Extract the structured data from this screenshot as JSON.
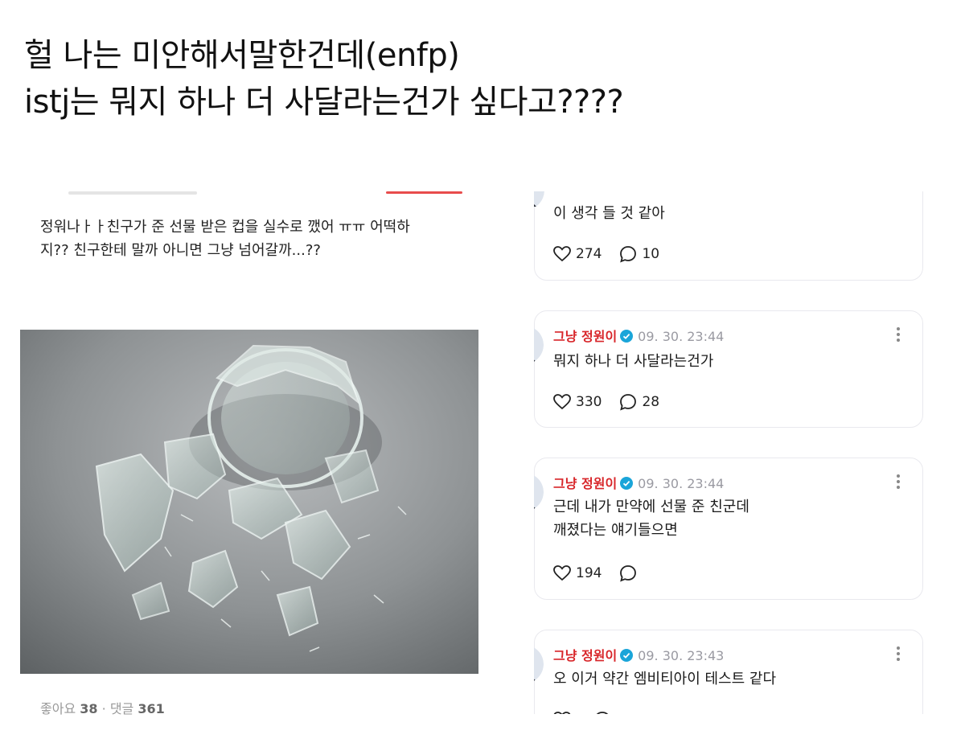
{
  "caption": {
    "line1": "헐 나는 미안해서말한건데(enfp)",
    "line2": "istj는 뭐지 하나 더 사달라는건가 싶다고????"
  },
  "post": {
    "text_line1": "정워나ㅏㅏ친구가 준 선물 받은 컵을 실수로 깼어 ㅠㅠ 어떡하",
    "text_line2": "지?? 친구한테 말까 아니면 그냥 넘어갈까...??",
    "likes_label": "좋아요",
    "likes": "38",
    "separator": "·",
    "comments_label": "댓글",
    "comments": "361"
  },
  "comments": [
    {
      "lines": [
        "이 생각 들 것 같아"
      ],
      "likes": "274",
      "replies": "10"
    },
    {
      "name": "그냥 정원이",
      "time": "09. 30. 23:44",
      "lines": [
        "뭐지 하나 더 사달라는건가"
      ],
      "likes": "330",
      "replies": "28"
    },
    {
      "name": "그냥 정원이",
      "time": "09. 30. 23:44",
      "lines": [
        "근데 내가 만약에 선물 준 친군데",
        "깨졌다는 얘기들으면"
      ],
      "likes": "194",
      "replies": ""
    },
    {
      "name": "그냥 정원이",
      "time": "09. 30. 23:43",
      "lines": [
        "오 이거 약간 엠비티아이 테스트 같다"
      ],
      "likes": "",
      "replies": ""
    }
  ],
  "icons": {
    "like": "heart-icon",
    "reply": "speech-bubble-icon",
    "more": "more-vertical-icon",
    "verified": "verified-badge-icon"
  },
  "colors": {
    "name": "#d8262a",
    "verified": "#1aa5d9",
    "time": "#9a9aa2",
    "card_border": "#e9e9ee"
  }
}
